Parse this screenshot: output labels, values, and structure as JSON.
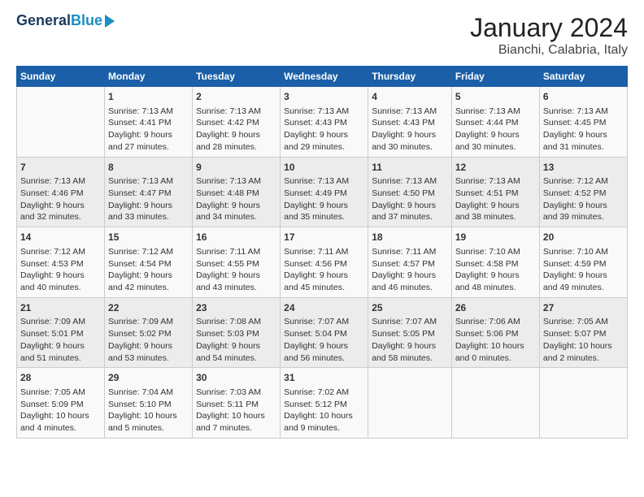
{
  "header": {
    "logo_line1": "General",
    "logo_line2": "Blue",
    "title": "January 2024",
    "subtitle": "Bianchi, Calabria, Italy"
  },
  "columns": [
    "Sunday",
    "Monday",
    "Tuesday",
    "Wednesday",
    "Thursday",
    "Friday",
    "Saturday"
  ],
  "weeks": [
    [
      {
        "day": "",
        "info": ""
      },
      {
        "day": "1",
        "info": "Sunrise: 7:13 AM\nSunset: 4:41 PM\nDaylight: 9 hours\nand 27 minutes."
      },
      {
        "day": "2",
        "info": "Sunrise: 7:13 AM\nSunset: 4:42 PM\nDaylight: 9 hours\nand 28 minutes."
      },
      {
        "day": "3",
        "info": "Sunrise: 7:13 AM\nSunset: 4:43 PM\nDaylight: 9 hours\nand 29 minutes."
      },
      {
        "day": "4",
        "info": "Sunrise: 7:13 AM\nSunset: 4:43 PM\nDaylight: 9 hours\nand 30 minutes."
      },
      {
        "day": "5",
        "info": "Sunrise: 7:13 AM\nSunset: 4:44 PM\nDaylight: 9 hours\nand 30 minutes."
      },
      {
        "day": "6",
        "info": "Sunrise: 7:13 AM\nSunset: 4:45 PM\nDaylight: 9 hours\nand 31 minutes."
      }
    ],
    [
      {
        "day": "7",
        "info": "Sunrise: 7:13 AM\nSunset: 4:46 PM\nDaylight: 9 hours\nand 32 minutes."
      },
      {
        "day": "8",
        "info": "Sunrise: 7:13 AM\nSunset: 4:47 PM\nDaylight: 9 hours\nand 33 minutes."
      },
      {
        "day": "9",
        "info": "Sunrise: 7:13 AM\nSunset: 4:48 PM\nDaylight: 9 hours\nand 34 minutes."
      },
      {
        "day": "10",
        "info": "Sunrise: 7:13 AM\nSunset: 4:49 PM\nDaylight: 9 hours\nand 35 minutes."
      },
      {
        "day": "11",
        "info": "Sunrise: 7:13 AM\nSunset: 4:50 PM\nDaylight: 9 hours\nand 37 minutes."
      },
      {
        "day": "12",
        "info": "Sunrise: 7:13 AM\nSunset: 4:51 PM\nDaylight: 9 hours\nand 38 minutes."
      },
      {
        "day": "13",
        "info": "Sunrise: 7:12 AM\nSunset: 4:52 PM\nDaylight: 9 hours\nand 39 minutes."
      }
    ],
    [
      {
        "day": "14",
        "info": "Sunrise: 7:12 AM\nSunset: 4:53 PM\nDaylight: 9 hours\nand 40 minutes."
      },
      {
        "day": "15",
        "info": "Sunrise: 7:12 AM\nSunset: 4:54 PM\nDaylight: 9 hours\nand 42 minutes."
      },
      {
        "day": "16",
        "info": "Sunrise: 7:11 AM\nSunset: 4:55 PM\nDaylight: 9 hours\nand 43 minutes."
      },
      {
        "day": "17",
        "info": "Sunrise: 7:11 AM\nSunset: 4:56 PM\nDaylight: 9 hours\nand 45 minutes."
      },
      {
        "day": "18",
        "info": "Sunrise: 7:11 AM\nSunset: 4:57 PM\nDaylight: 9 hours\nand 46 minutes."
      },
      {
        "day": "19",
        "info": "Sunrise: 7:10 AM\nSunset: 4:58 PM\nDaylight: 9 hours\nand 48 minutes."
      },
      {
        "day": "20",
        "info": "Sunrise: 7:10 AM\nSunset: 4:59 PM\nDaylight: 9 hours\nand 49 minutes."
      }
    ],
    [
      {
        "day": "21",
        "info": "Sunrise: 7:09 AM\nSunset: 5:01 PM\nDaylight: 9 hours\nand 51 minutes."
      },
      {
        "day": "22",
        "info": "Sunrise: 7:09 AM\nSunset: 5:02 PM\nDaylight: 9 hours\nand 53 minutes."
      },
      {
        "day": "23",
        "info": "Sunrise: 7:08 AM\nSunset: 5:03 PM\nDaylight: 9 hours\nand 54 minutes."
      },
      {
        "day": "24",
        "info": "Sunrise: 7:07 AM\nSunset: 5:04 PM\nDaylight: 9 hours\nand 56 minutes."
      },
      {
        "day": "25",
        "info": "Sunrise: 7:07 AM\nSunset: 5:05 PM\nDaylight: 9 hours\nand 58 minutes."
      },
      {
        "day": "26",
        "info": "Sunrise: 7:06 AM\nSunset: 5:06 PM\nDaylight: 10 hours\nand 0 minutes."
      },
      {
        "day": "27",
        "info": "Sunrise: 7:05 AM\nSunset: 5:07 PM\nDaylight: 10 hours\nand 2 minutes."
      }
    ],
    [
      {
        "day": "28",
        "info": "Sunrise: 7:05 AM\nSunset: 5:09 PM\nDaylight: 10 hours\nand 4 minutes."
      },
      {
        "day": "29",
        "info": "Sunrise: 7:04 AM\nSunset: 5:10 PM\nDaylight: 10 hours\nand 5 minutes."
      },
      {
        "day": "30",
        "info": "Sunrise: 7:03 AM\nSunset: 5:11 PM\nDaylight: 10 hours\nand 7 minutes."
      },
      {
        "day": "31",
        "info": "Sunrise: 7:02 AM\nSunset: 5:12 PM\nDaylight: 10 hours\nand 9 minutes."
      },
      {
        "day": "",
        "info": ""
      },
      {
        "day": "",
        "info": ""
      },
      {
        "day": "",
        "info": ""
      }
    ]
  ]
}
